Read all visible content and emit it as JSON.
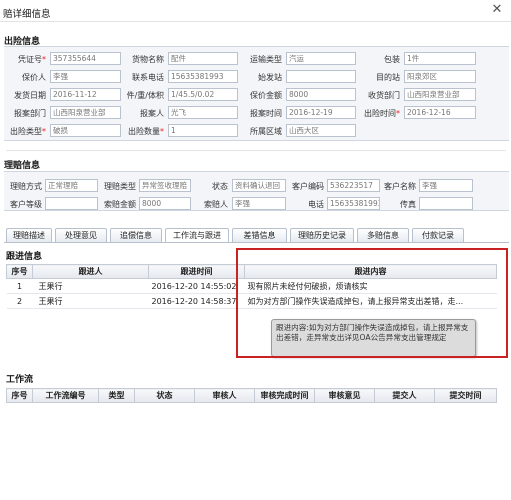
{
  "window": {
    "title": "赔详细信息"
  },
  "shipment": {
    "title": "出险信息",
    "fields": {
      "voucher_no": {
        "label": "凭证号",
        "value": "357355644"
      },
      "goods_name": {
        "label": "货物名称",
        "value": "配件"
      },
      "transport_type": {
        "label": "运输类型",
        "value": "汽运"
      },
      "package": {
        "label": "包装",
        "value": "1件"
      },
      "insured": {
        "label": "保价人",
        "value": "李强"
      },
      "contact_phone": {
        "label": "联系电话",
        "value": "15635381993"
      },
      "origin": {
        "label": "始发站",
        "value": ""
      },
      "destination": {
        "label": "目的站",
        "value": "阳泉郊区"
      },
      "ship_date": {
        "label": "发货日期",
        "value": "2016-11-12"
      },
      "pieces_weight_volume": {
        "label": "件/重/体积",
        "value": "1/45.5/0.02"
      },
      "insured_amount": {
        "label": "保价金额",
        "value": "8000"
      },
      "receiving_dept": {
        "label": "收货部门",
        "value": "山西阳泉营业部"
      },
      "report_dept": {
        "label": "报案部门",
        "value": "山西阳泉营业部"
      },
      "reporter": {
        "label": "报案人",
        "value": "光飞"
      },
      "report_time": {
        "label": "报案时间",
        "value": "2016-12-19"
      },
      "incident_time": {
        "label": "出险时间",
        "value": "2016-12-16"
      },
      "incident_type": {
        "label": "出险类型",
        "value": "破损"
      },
      "incident_qty": {
        "label": "出险数量",
        "value": "1"
      },
      "region": {
        "label": "所属区域",
        "value": "山西大区"
      }
    }
  },
  "claim": {
    "title": "理赔信息",
    "fields": {
      "claim_method": {
        "label": "理赔方式",
        "value": "正常理赔"
      },
      "claim_type": {
        "label": "理赔类型",
        "value": "异常签收理赔"
      },
      "status": {
        "label": "状态",
        "value": "资料确认退回"
      },
      "customer_code": {
        "label": "客户编码",
        "value": "536223517"
      },
      "customer_name": {
        "label": "客户名称",
        "value": "李强"
      },
      "customer_level": {
        "label": "客户等级",
        "value": ""
      },
      "claim_amount": {
        "label": "索赔金额",
        "value": "8000"
      },
      "claimant": {
        "label": "索赔人",
        "value": "李强"
      },
      "phone": {
        "label": "电话",
        "value": "15635381993"
      },
      "fax": {
        "label": "传真",
        "value": ""
      }
    }
  },
  "tabs": [
    {
      "label": "理赔描述"
    },
    {
      "label": "处理意见"
    },
    {
      "label": "追偿信息"
    },
    {
      "label": "工作流与跟进"
    },
    {
      "label": "差错信息"
    },
    {
      "label": "理赔历史记录"
    },
    {
      "label": "多赔信息"
    },
    {
      "label": "付款记录"
    }
  ],
  "followup": {
    "title": "跟进信息",
    "columns": [
      "序号",
      "跟进人",
      "跟进时间",
      "跟进内容"
    ],
    "rows": [
      {
        "no": "1",
        "person": "王果行",
        "time": "2016-12-20 14:55:02",
        "content": "现有照片未经付何破损，烦请核实"
      },
      {
        "no": "2",
        "person": "王果行",
        "time": "2016-12-20 14:58:37",
        "content": "如为对方部门操作失误造成掉包，请上报异常支出差错，走..."
      }
    ],
    "tooltip": "跟进内容:如为对方部门操作失误造成掉包，请上报异常支出差错，走异常支出详见OA公告异常支出管理规定"
  },
  "workflow": {
    "title": "工作流",
    "columns": [
      "序号",
      "工作流编号",
      "类型",
      "状态",
      "审核人",
      "审核完成时间",
      "审核意见",
      "提交人",
      "提交时间"
    ]
  }
}
